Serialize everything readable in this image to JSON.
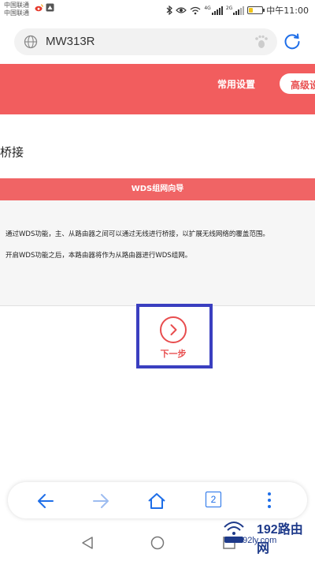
{
  "status_bar": {
    "carrier1": "中国联通",
    "carrier2": "中国联通",
    "time": "中午11:00",
    "network1": "4G",
    "network2": "2G"
  },
  "browser": {
    "url": "MW313R",
    "tab_count": "2"
  },
  "header": {
    "nav_common": "常用设置",
    "nav_advanced": "高级设"
  },
  "page": {
    "title": "桥接",
    "banner": "WDS组网向导",
    "description_1": "通过WDS功能，主、从路由器之间可以通过无线进行桥接，以扩展无线网络的覆盖范围。",
    "description_2": "开启WDS功能之后，本路由器将作为从路由器进行WDS组网。",
    "next_label": "下一步"
  },
  "watermark": {
    "text": "192路由网",
    "sub": "192ly.com"
  },
  "colors": {
    "accent_red": "#f25d5e",
    "banner_red": "#f06465",
    "highlight_blue": "#3a3fc0",
    "browser_blue": "#1e6ee8"
  }
}
